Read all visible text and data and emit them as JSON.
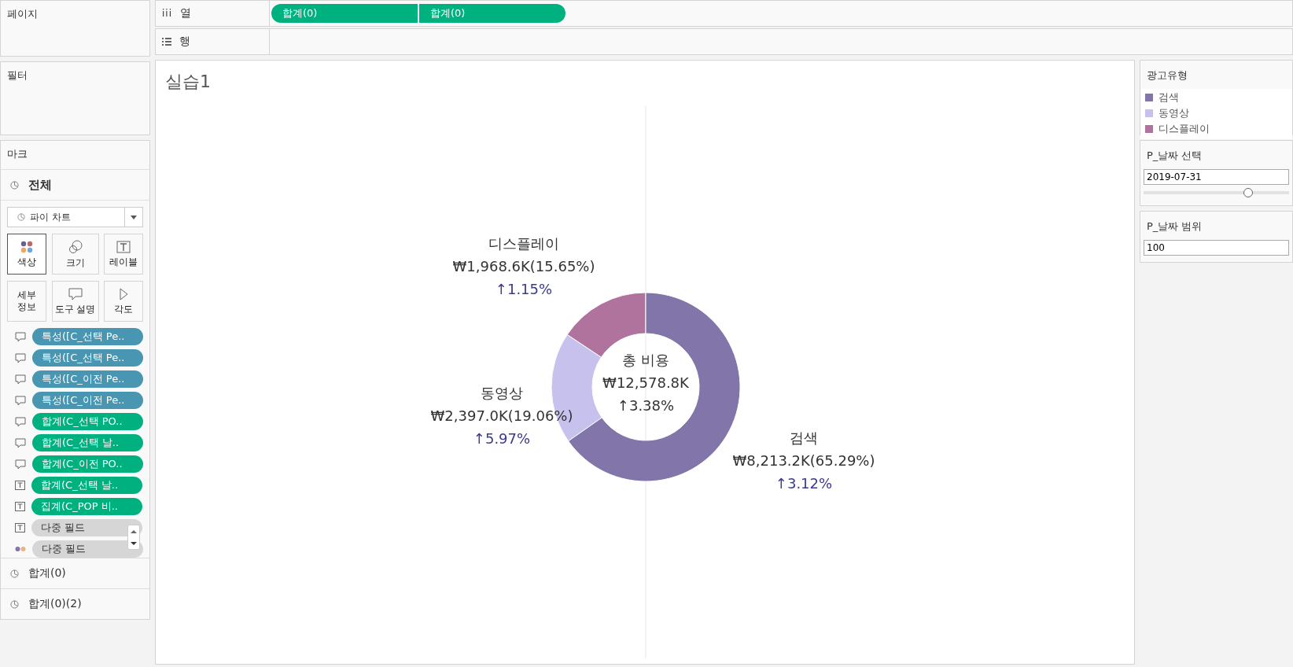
{
  "pages": {
    "title": "페이지"
  },
  "shelves": [
    {
      "kind": "columns",
      "icon": "iii",
      "label": "열",
      "pills": [
        "합계(0)",
        "합계(0)"
      ]
    },
    {
      "kind": "rows",
      "label": "행"
    }
  ],
  "filters": {
    "title": "필터"
  },
  "marks": {
    "title": "마크",
    "layers": [
      {
        "label": "전체",
        "selected": true
      },
      {
        "label": "합계(0)",
        "selected": false
      },
      {
        "label": "합계(0)(2)",
        "selected": false
      }
    ],
    "mark_type": "파이 차트",
    "cards": [
      {
        "kind": "color",
        "label": "색상",
        "selected": true
      },
      {
        "kind": "size",
        "label": "크기",
        "selected": false
      },
      {
        "kind": "label",
        "label": "레이블",
        "selected": false
      },
      {
        "kind": "detail",
        "label": "세부\n정보",
        "selected": false
      },
      {
        "kind": "tooltip",
        "label": "도구 설명",
        "selected": false
      },
      {
        "kind": "angle",
        "label": "각도",
        "selected": false
      }
    ],
    "fields": [
      {
        "kind": "tooltip",
        "color": "#4996b2",
        "text": "특성([C_선택 Pe.."
      },
      {
        "kind": "tooltip",
        "color": "#4996b2",
        "text": "특성([C_선택 Pe.."
      },
      {
        "kind": "tooltip",
        "color": "#4996b2",
        "text": "특성([C_이전 Pe.."
      },
      {
        "kind": "tooltip",
        "color": "#4996b2",
        "text": "특성([C_이전 Pe.."
      },
      {
        "kind": "tooltip",
        "color": "#00b180",
        "text": "합계(C_선택 PO.."
      },
      {
        "kind": "tooltip",
        "color": "#00b180",
        "text": "합계(C_선택 날.."
      },
      {
        "kind": "tooltip",
        "color": "#00b180",
        "text": "합계(C_이전 PO.."
      },
      {
        "kind": "label",
        "color": "#00b180",
        "text": "합계(C_선택 날.."
      },
      {
        "kind": "label",
        "color": "#00b180",
        "text": "집계(C_POP 비.."
      },
      {
        "kind": "label",
        "color": "#d6d6d6",
        "text": "다중 필드"
      },
      {
        "kind": "color",
        "color": "#d6d6d6",
        "text": "다중 필드"
      }
    ]
  },
  "sheet": {
    "title": "실습1",
    "center": {
      "title": "총 비용",
      "value": "₩12,578.8K",
      "change": "↑3.38%"
    },
    "chart_data": {
      "type": "donut",
      "categories": [
        "디스플레이",
        "동영상",
        "검색"
      ],
      "values": [
        15.65,
        19.06,
        65.29
      ]
    },
    "labels": [
      {
        "value": "₩1,968.6K(15.65%)",
        "change": "↑1.15%"
      },
      {
        "value": "₩2,397.0K(19.06%)",
        "change": "↑5.97%"
      },
      {
        "value": "₩8,213.2K(65.29%)",
        "change": "↑3.12%"
      }
    ]
  },
  "legend": {
    "title": "광고유형",
    "items": [
      {
        "label": "검색",
        "color": "#8175aa"
      },
      {
        "label": "동영상",
        "color": "#c6c1ed"
      },
      {
        "label": "디스플레이",
        "color": "#b0739e"
      }
    ]
  },
  "parameters": [
    {
      "kind": "slider",
      "title": "P_날짜 선택",
      "value": "2019-07-31",
      "level": 0.72
    },
    {
      "kind": "text",
      "title": "P_날짜 범위",
      "value": "100"
    }
  ]
}
